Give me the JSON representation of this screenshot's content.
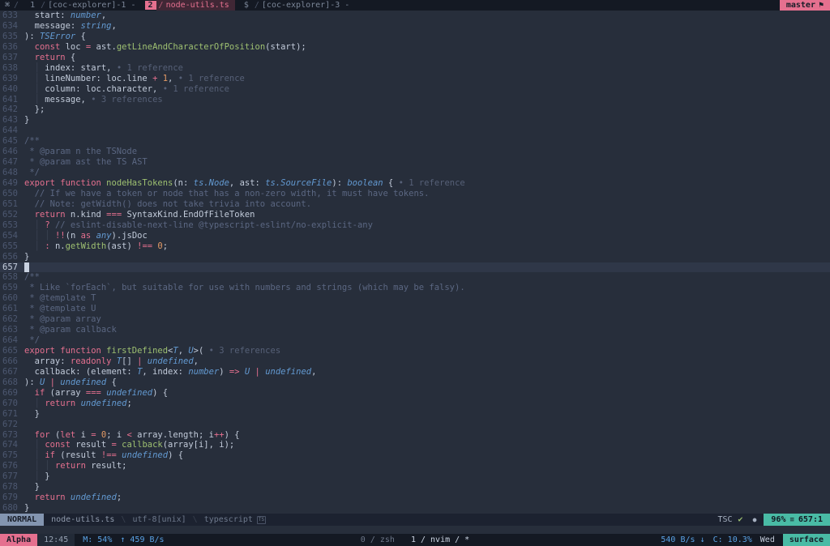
{
  "tmux_top": {
    "session_icon": "⌘",
    "separator": "/",
    "windows": [
      {
        "index": "1",
        "name": "[coc-explorer]-1 -",
        "active": false
      },
      {
        "index": "2",
        "name": "node-utils.ts",
        "active": true
      },
      {
        "index": "$",
        "name": "[coc-explorer]-3 -",
        "active": false
      }
    ],
    "branch": "master",
    "branch_icon": "⚑"
  },
  "editor": {
    "cursor_line": 657,
    "lines": [
      {
        "n": 633,
        "s": [
          [
            "  start: ",
            "f"
          ],
          [
            "number",
            "t"
          ],
          [
            ",",
            "f"
          ]
        ]
      },
      {
        "n": 634,
        "s": [
          [
            "  message: ",
            "f"
          ],
          [
            "string",
            "t"
          ],
          [
            ",",
            "f"
          ]
        ]
      },
      {
        "n": 635,
        "s": [
          [
            "): ",
            "f"
          ],
          [
            "TSError",
            "t"
          ],
          [
            " {",
            "f"
          ]
        ]
      },
      {
        "n": 636,
        "s": [
          [
            "  ",
            "f"
          ],
          [
            "const",
            "k"
          ],
          [
            " loc ",
            "f"
          ],
          [
            "=",
            "k"
          ],
          [
            " ast.",
            "f"
          ],
          [
            "getLineAndCharacterOfPosition",
            "g"
          ],
          [
            "(start);",
            "f"
          ]
        ]
      },
      {
        "n": 637,
        "s": [
          [
            "  ",
            "f"
          ],
          [
            "return",
            "k"
          ],
          [
            " {",
            "f"
          ]
        ]
      },
      {
        "n": 638,
        "s": [
          [
            "  ",
            "f"
          ],
          [
            "│",
            "i"
          ],
          [
            " index: start,",
            "f"
          ],
          [
            " • 1 reference",
            "l"
          ]
        ]
      },
      {
        "n": 639,
        "s": [
          [
            "  ",
            "f"
          ],
          [
            "│",
            "i"
          ],
          [
            " lineNumber: loc.line ",
            "f"
          ],
          [
            "+",
            "k"
          ],
          [
            " ",
            "f"
          ],
          [
            "1",
            "n"
          ],
          [
            ",",
            "f"
          ],
          [
            " • 1 reference",
            "l"
          ]
        ]
      },
      {
        "n": 640,
        "s": [
          [
            "  ",
            "f"
          ],
          [
            "│",
            "i"
          ],
          [
            " column: loc.character,",
            "f"
          ],
          [
            " • 1 reference",
            "l"
          ]
        ]
      },
      {
        "n": 641,
        "s": [
          [
            "  ",
            "f"
          ],
          [
            "│",
            "i"
          ],
          [
            " message,",
            "f"
          ],
          [
            " • 3 references",
            "l"
          ]
        ]
      },
      {
        "n": 642,
        "s": [
          [
            "  };",
            "f"
          ]
        ]
      },
      {
        "n": 643,
        "s": [
          [
            "}",
            "f"
          ]
        ]
      },
      {
        "n": 644,
        "s": []
      },
      {
        "n": 645,
        "s": [
          [
            "/**",
            "c"
          ]
        ]
      },
      {
        "n": 646,
        "s": [
          [
            " * @param n the TSNode",
            "c"
          ]
        ]
      },
      {
        "n": 647,
        "s": [
          [
            " * @param ast the TS AST",
            "c"
          ]
        ]
      },
      {
        "n": 648,
        "s": [
          [
            " */",
            "c"
          ]
        ]
      },
      {
        "n": 649,
        "s": [
          [
            "export",
            "k"
          ],
          [
            " ",
            "f"
          ],
          [
            "function",
            "k"
          ],
          [
            " ",
            "f"
          ],
          [
            "nodeHasTokens",
            "g"
          ],
          [
            "(n: ",
            "f"
          ],
          [
            "ts.Node",
            "t"
          ],
          [
            ", ast: ",
            "f"
          ],
          [
            "ts.SourceFile",
            "t"
          ],
          [
            "): ",
            "f"
          ],
          [
            "boolean",
            "t"
          ],
          [
            " { ",
            "f"
          ],
          [
            "• 1 reference",
            "l"
          ]
        ]
      },
      {
        "n": 650,
        "s": [
          [
            "  ",
            "f"
          ],
          [
            "// If we have a token or node that has a non-zero width, it must have tokens.",
            "c"
          ]
        ]
      },
      {
        "n": 651,
        "s": [
          [
            "  ",
            "f"
          ],
          [
            "// Note: getWidth() does not take trivia into account.",
            "c"
          ]
        ]
      },
      {
        "n": 652,
        "s": [
          [
            "  ",
            "f"
          ],
          [
            "return",
            "k"
          ],
          [
            " n.kind ",
            "f"
          ],
          [
            "===",
            "k"
          ],
          [
            " SyntaxKind.EndOfFileToken",
            "f"
          ]
        ]
      },
      {
        "n": 653,
        "s": [
          [
            "  ",
            "f"
          ],
          [
            "│",
            "i"
          ],
          [
            " ",
            "f"
          ],
          [
            "?",
            "k"
          ],
          [
            " ",
            "f"
          ],
          [
            "// eslint-disable-next-line @typescript-eslint/no-explicit-any",
            "c"
          ]
        ]
      },
      {
        "n": 654,
        "s": [
          [
            "  ",
            "f"
          ],
          [
            "│",
            "i"
          ],
          [
            " ",
            "f"
          ],
          [
            "│",
            "i"
          ],
          [
            " ",
            "f"
          ],
          [
            "!!",
            "k"
          ],
          [
            "(n ",
            "f"
          ],
          [
            "as",
            "k"
          ],
          [
            " ",
            "f"
          ],
          [
            "any",
            "t"
          ],
          [
            ").jsDoc",
            "f"
          ]
        ]
      },
      {
        "n": 655,
        "s": [
          [
            "  ",
            "f"
          ],
          [
            "│",
            "i"
          ],
          [
            " ",
            "f"
          ],
          [
            ":",
            "k"
          ],
          [
            " n.",
            "f"
          ],
          [
            "getWidth",
            "g"
          ],
          [
            "(ast) ",
            "f"
          ],
          [
            "!==",
            "k"
          ],
          [
            " ",
            "f"
          ],
          [
            "0",
            "n"
          ],
          [
            ";",
            "f"
          ]
        ]
      },
      {
        "n": 656,
        "s": [
          [
            "}",
            "f"
          ]
        ]
      },
      {
        "n": 657,
        "s": []
      },
      {
        "n": 658,
        "s": [
          [
            "/**",
            "c"
          ]
        ]
      },
      {
        "n": 659,
        "s": [
          [
            " * Like `forEach`, but suitable for use with numbers and strings (which may be falsy).",
            "c"
          ]
        ]
      },
      {
        "n": 660,
        "s": [
          [
            " * @template T",
            "c"
          ]
        ]
      },
      {
        "n": 661,
        "s": [
          [
            " * @template U",
            "c"
          ]
        ]
      },
      {
        "n": 662,
        "s": [
          [
            " * @param array",
            "c"
          ]
        ]
      },
      {
        "n": 663,
        "s": [
          [
            " * @param callback",
            "c"
          ]
        ]
      },
      {
        "n": 664,
        "s": [
          [
            " */",
            "c"
          ]
        ]
      },
      {
        "n": 665,
        "s": [
          [
            "export",
            "k"
          ],
          [
            " ",
            "f"
          ],
          [
            "function",
            "k"
          ],
          [
            " ",
            "f"
          ],
          [
            "firstDefined",
            "g"
          ],
          [
            "<",
            "f"
          ],
          [
            "T",
            "t"
          ],
          [
            ", ",
            "f"
          ],
          [
            "U",
            "t"
          ],
          [
            ">( ",
            "f"
          ],
          [
            "• 3 references",
            "l"
          ]
        ]
      },
      {
        "n": 666,
        "s": [
          [
            "  array: ",
            "f"
          ],
          [
            "readonly",
            "k"
          ],
          [
            " ",
            "f"
          ],
          [
            "T",
            "t"
          ],
          [
            "[] ",
            "f"
          ],
          [
            "|",
            "k"
          ],
          [
            " ",
            "f"
          ],
          [
            "undefined",
            "t"
          ],
          [
            ",",
            "f"
          ]
        ]
      },
      {
        "n": 667,
        "s": [
          [
            "  callback: (element: ",
            "f"
          ],
          [
            "T",
            "t"
          ],
          [
            ", index: ",
            "f"
          ],
          [
            "number",
            "t"
          ],
          [
            ") ",
            "f"
          ],
          [
            "=>",
            "k"
          ],
          [
            " ",
            "f"
          ],
          [
            "U",
            "t"
          ],
          [
            " ",
            "f"
          ],
          [
            "|",
            "k"
          ],
          [
            " ",
            "f"
          ],
          [
            "undefined",
            "t"
          ],
          [
            ",",
            "f"
          ]
        ]
      },
      {
        "n": 668,
        "s": [
          [
            "): ",
            "f"
          ],
          [
            "U",
            "t"
          ],
          [
            " ",
            "f"
          ],
          [
            "|",
            "k"
          ],
          [
            " ",
            "f"
          ],
          [
            "undefined",
            "t"
          ],
          [
            " {",
            "f"
          ]
        ]
      },
      {
        "n": 669,
        "s": [
          [
            "  ",
            "f"
          ],
          [
            "if",
            "k"
          ],
          [
            " (array ",
            "f"
          ],
          [
            "===",
            "k"
          ],
          [
            " ",
            "f"
          ],
          [
            "undefined",
            "t"
          ],
          [
            ") {",
            "f"
          ]
        ]
      },
      {
        "n": 670,
        "s": [
          [
            "  ",
            "f"
          ],
          [
            "│",
            "i"
          ],
          [
            " ",
            "f"
          ],
          [
            "return",
            "k"
          ],
          [
            " ",
            "f"
          ],
          [
            "undefined",
            "t"
          ],
          [
            ";",
            "f"
          ]
        ]
      },
      {
        "n": 671,
        "s": [
          [
            "  }",
            "f"
          ]
        ]
      },
      {
        "n": 672,
        "s": []
      },
      {
        "n": 673,
        "s": [
          [
            "  ",
            "f"
          ],
          [
            "for",
            "k"
          ],
          [
            " (",
            "f"
          ],
          [
            "let",
            "k"
          ],
          [
            " i ",
            "f"
          ],
          [
            "=",
            "k"
          ],
          [
            " ",
            "f"
          ],
          [
            "0",
            "n"
          ],
          [
            "; i ",
            "f"
          ],
          [
            "<",
            "k"
          ],
          [
            " array.length; i",
            "f"
          ],
          [
            "++",
            "k"
          ],
          [
            ") {",
            "f"
          ]
        ]
      },
      {
        "n": 674,
        "s": [
          [
            "  ",
            "f"
          ],
          [
            "│",
            "i"
          ],
          [
            " ",
            "f"
          ],
          [
            "const",
            "k"
          ],
          [
            " result ",
            "f"
          ],
          [
            "=",
            "k"
          ],
          [
            " ",
            "f"
          ],
          [
            "callback",
            "g"
          ],
          [
            "(array[i], i);",
            "f"
          ]
        ]
      },
      {
        "n": 675,
        "s": [
          [
            "  ",
            "f"
          ],
          [
            "│",
            "i"
          ],
          [
            " ",
            "f"
          ],
          [
            "if",
            "k"
          ],
          [
            " (result ",
            "f"
          ],
          [
            "!==",
            "k"
          ],
          [
            " ",
            "f"
          ],
          [
            "undefined",
            "t"
          ],
          [
            ") {",
            "f"
          ]
        ]
      },
      {
        "n": 676,
        "s": [
          [
            "  ",
            "f"
          ],
          [
            "│",
            "i"
          ],
          [
            " ",
            "f"
          ],
          [
            "│",
            "i"
          ],
          [
            " ",
            "f"
          ],
          [
            "return",
            "k"
          ],
          [
            " result;",
            "f"
          ]
        ]
      },
      {
        "n": 677,
        "s": [
          [
            "  ",
            "f"
          ],
          [
            "│",
            "i"
          ],
          [
            " }",
            "f"
          ]
        ]
      },
      {
        "n": 678,
        "s": [
          [
            "  }",
            "f"
          ]
        ]
      },
      {
        "n": 679,
        "s": [
          [
            "  ",
            "f"
          ],
          [
            "return",
            "k"
          ],
          [
            " ",
            "f"
          ],
          [
            "undefined",
            "t"
          ],
          [
            ";",
            "f"
          ]
        ]
      },
      {
        "n": 680,
        "s": [
          [
            "}",
            "f"
          ]
        ]
      }
    ]
  },
  "statusline": {
    "mode": "NORMAL",
    "filename": "node-utils.ts",
    "separator": "\\",
    "encoding": "utf-8[unix]",
    "filetype": "typescript",
    "filetype_icon": "TS",
    "lsp": "TSC",
    "check_icon": "✔",
    "dot_icon": "●",
    "percent": "96%",
    "position_icon": "≡",
    "position": "657:1"
  },
  "tmux_bottom": {
    "session": "Alpha",
    "time": "12:45",
    "mem": "M: 54%",
    "up_icon": "↑",
    "up_rate": "459 B/s",
    "separator": "/",
    "windows": [
      {
        "index": "0",
        "name": "zsh",
        "flag": "",
        "active": false
      },
      {
        "index": "1",
        "name": "nvim",
        "flag": "*",
        "active": true
      }
    ],
    "down_rate": "540 B/s",
    "down_icon": "↓",
    "cpu": "C: 10.3%",
    "day": "Wed",
    "host": "surface"
  }
}
